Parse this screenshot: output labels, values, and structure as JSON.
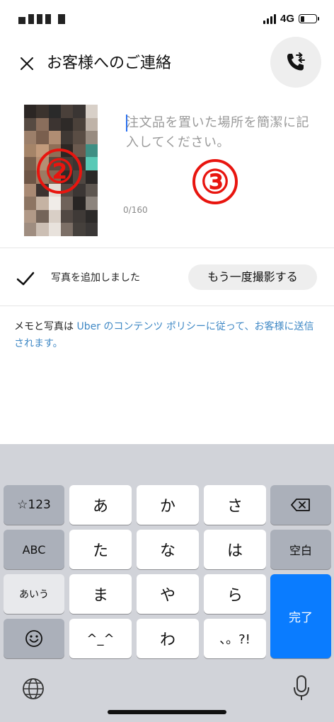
{
  "status_bar": {
    "network": "4G",
    "battery_level": 0.28
  },
  "header": {
    "title": "お客様へのご連絡"
  },
  "memo": {
    "placeholder": "注文品を置いた場所を簡潔に記入してください。",
    "counter": "0/160"
  },
  "annotations": {
    "marker_photo": "②",
    "marker_memo": "③"
  },
  "photo_row": {
    "added_label": "写真を追加しました",
    "retake_label": "もう一度撮影する"
  },
  "notice": {
    "prefix": "メモと写真は ",
    "link": "Uber のコンテンツ ポリシー",
    "middle": "に従って、",
    "link2": "お客様",
    "suffix": "に送信されます。"
  },
  "keyboard": {
    "row1": [
      "☆123",
      "あ",
      "か",
      "さ"
    ],
    "row2": [
      "ABC",
      "た",
      "な",
      "は",
      "空白"
    ],
    "row3": [
      "あいう",
      "ま",
      "や",
      "ら"
    ],
    "row4": [
      "^_^",
      "わ",
      "、。?!"
    ],
    "done": "完了"
  },
  "colors": {
    "accent": "#276ef1",
    "link": "#3f88c5",
    "done_key": "#0a7cff",
    "marker": "#e8150f"
  }
}
